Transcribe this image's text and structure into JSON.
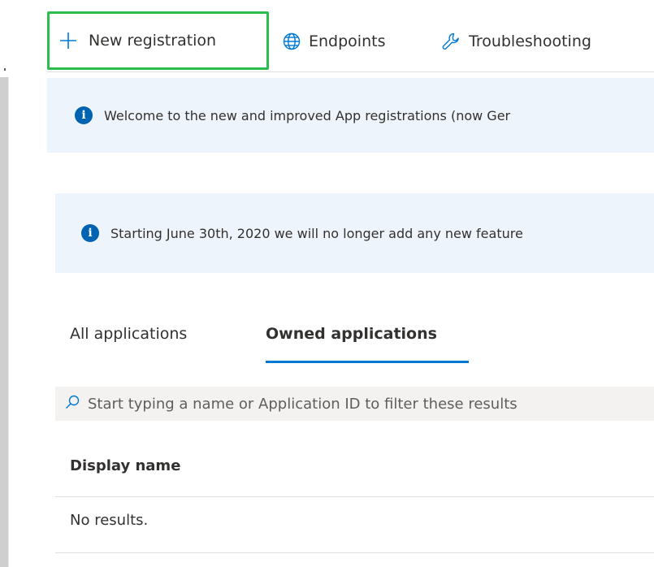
{
  "toolbar": {
    "new_registration_label": "New registration",
    "endpoints_label": "Endpoints",
    "troubleshooting_label": "Troubleshooting"
  },
  "banners": [
    {
      "text": "Welcome to the new and improved App registrations (now Ger"
    },
    {
      "text": "Starting June 30th, 2020 we will no longer add any new feature"
    }
  ],
  "tabs": [
    {
      "label": "All applications",
      "selected": false
    },
    {
      "label": "Owned applications",
      "selected": true
    }
  ],
  "search": {
    "placeholder": "Start typing a name or Application ID to filter these results"
  },
  "table": {
    "columns": [
      "Display name"
    ],
    "empty_text": "No results."
  },
  "icons": {
    "new_registration": "plus-icon",
    "endpoints": "globe-icon",
    "troubleshooting": "wrench-icon",
    "info": "info-icon",
    "search": "search-icon"
  },
  "colors": {
    "accent": "#0078d4",
    "highlight_box": "#2dbd4e",
    "banner_bg": "#eef4fb",
    "info_icon": "#0063b1"
  }
}
